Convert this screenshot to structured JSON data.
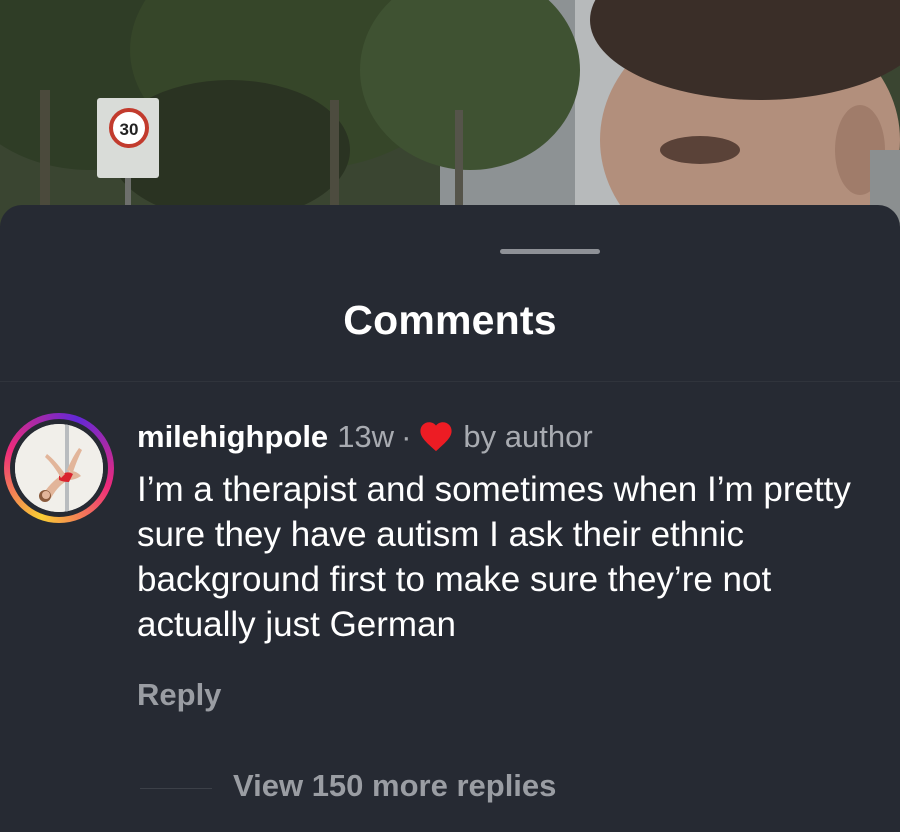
{
  "sheet": {
    "title": "Comments"
  },
  "comment": {
    "username": "milehighpole",
    "age": "13w",
    "separator": "·",
    "liked_label": "by author",
    "text": "I’m a therapist and sometimes when I’m pretty sure they have autism I ask their ethnic background first to make sure they’re not actually just German",
    "reply_label": "Reply",
    "view_replies_label": "View 150 more replies"
  },
  "background": {
    "sign_value": "30"
  },
  "colors": {
    "sheet_bg": "#262a33",
    "heart": "#ed1c24",
    "avatar_ring": [
      "#f9ce34",
      "#ee2a7b",
      "#6228d7"
    ]
  },
  "icons": {
    "heart": "heart-icon",
    "avatar": "avatar"
  }
}
